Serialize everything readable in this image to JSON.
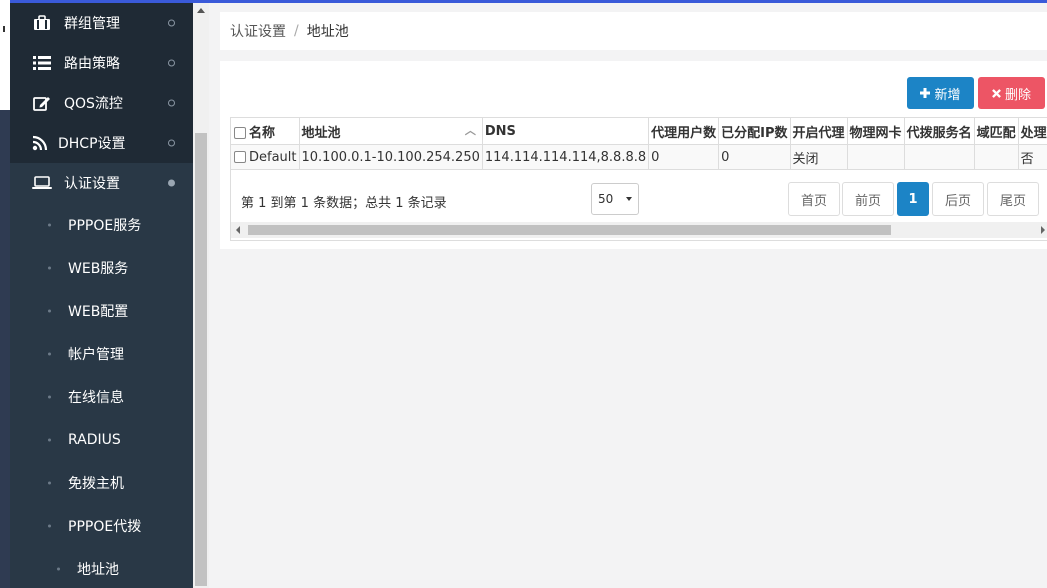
{
  "sidebar": {
    "items": [
      {
        "label": "群组管理",
        "icon": "briefcase-icon"
      },
      {
        "label": "路由策略",
        "icon": "list-icon"
      },
      {
        "label": "QOS流控",
        "icon": "edit-icon"
      },
      {
        "label": "DHCP设置",
        "icon": "rss-icon"
      },
      {
        "label": "认证设置",
        "icon": "laptop-icon"
      }
    ],
    "submenu": [
      {
        "label": "PPPOE服务"
      },
      {
        "label": "WEB服务"
      },
      {
        "label": "WEB配置"
      },
      {
        "label": "帐户管理"
      },
      {
        "label": "在线信息"
      },
      {
        "label": "RADIUS"
      },
      {
        "label": "免拨主机"
      },
      {
        "label": "PPPOE代拨"
      },
      {
        "label": "地址池"
      }
    ]
  },
  "breadcrumb": {
    "parent": "认证设置",
    "separator": "/",
    "current": "地址池"
  },
  "toolbar": {
    "add_label": "新增",
    "delete_label": "删除",
    "add_icon": "plus-icon",
    "delete_icon": "close-icon"
  },
  "table": {
    "headers": [
      "名称",
      "地址池",
      "DNS",
      "代理用户数",
      "已分配IP数",
      "开启代理",
      "物理网卡",
      "代拨服务名",
      "域匹配",
      "处理VLAN"
    ],
    "rows": [
      [
        "Default",
        "10.100.0.1-10.100.254.250",
        "114.114.114.114,8.8.8.8",
        "0",
        "0",
        "关闭",
        "",
        "",
        "",
        "否"
      ]
    ]
  },
  "pagination": {
    "info": "第 1 到第 1 条数据；总共 1 条记录",
    "page_size": "50",
    "first": "首页",
    "prev": "前页",
    "current": "1",
    "next": "后页",
    "last": "尾页"
  },
  "colors": {
    "sidebar": "#2f4050",
    "primary": "#1c84c6",
    "danger": "#ed5565"
  }
}
